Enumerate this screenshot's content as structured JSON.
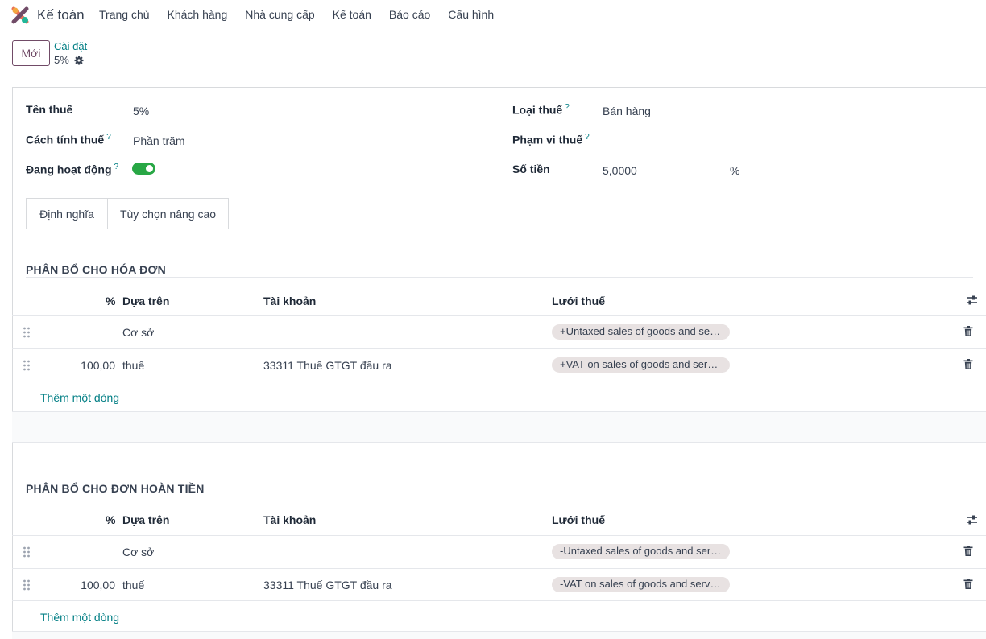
{
  "app": {
    "name": "Kế toán"
  },
  "menu": [
    "Trang chủ",
    "Khách hàng",
    "Nhà cung cấp",
    "Kế toán",
    "Báo cáo",
    "Cấu hình"
  ],
  "control": {
    "new_label": "Mới",
    "breadcrumb_parent": "Cài đặt",
    "breadcrumb_current": "5%"
  },
  "form": {
    "tax_name_label": "Tên thuế",
    "tax_name_value": "5%",
    "computation_label": "Cách tính thuế",
    "computation_value": "Phần trăm",
    "active_label": "Đang hoạt động",
    "active_value": true,
    "tax_type_label": "Loại thuế",
    "tax_type_value": "Bán hàng",
    "tax_scope_label": "Phạm vi thuế",
    "tax_scope_value": "",
    "amount_label": "Số tiền",
    "amount_value": "5,0000",
    "amount_unit": "%",
    "help_mark": "?"
  },
  "tabs": [
    "Định nghĩa",
    "Tùy chọn nâng cao"
  ],
  "invoice_section": {
    "title": "PHÂN BỔ CHO HÓA ĐƠN",
    "headers": {
      "percent": "%",
      "based_on": "Dựa trên",
      "account": "Tài khoản",
      "tax_grids": "Lưới thuế"
    },
    "rows": [
      {
        "percent": "",
        "based_on": "Cơ sở",
        "account": "",
        "tax_grid": "+Untaxed sales of goods and services"
      },
      {
        "percent": "100,00",
        "based_on": "thuế",
        "account": "33311 Thuế GTGT đầu ra",
        "tax_grid": "+VAT on sales of goods and services"
      }
    ],
    "add_line": "Thêm một dòng"
  },
  "refund_section": {
    "title": "PHÂN BỔ CHO ĐƠN HOÀN TIỀN",
    "headers": {
      "percent": "%",
      "based_on": "Dựa trên",
      "account": "Tài khoản",
      "tax_grids": "Lưới thuế"
    },
    "rows": [
      {
        "percent": "",
        "based_on": "Cơ sở",
        "account": "",
        "tax_grid": "-Untaxed sales of goods and services"
      },
      {
        "percent": "100,00",
        "based_on": "thuế",
        "account": "33311 Thuế GTGT đầu ra",
        "tax_grid": "-VAT on sales of goods and services"
      }
    ],
    "add_line": "Thêm một dòng"
  },
  "colors": {
    "brand": "#714b67",
    "link": "#017e84",
    "toggle_on": "#28a745"
  },
  "icons": [
    "app-logo-icon",
    "gear-icon",
    "drag-handle-icon",
    "trash-icon",
    "optional-columns-icon"
  ]
}
